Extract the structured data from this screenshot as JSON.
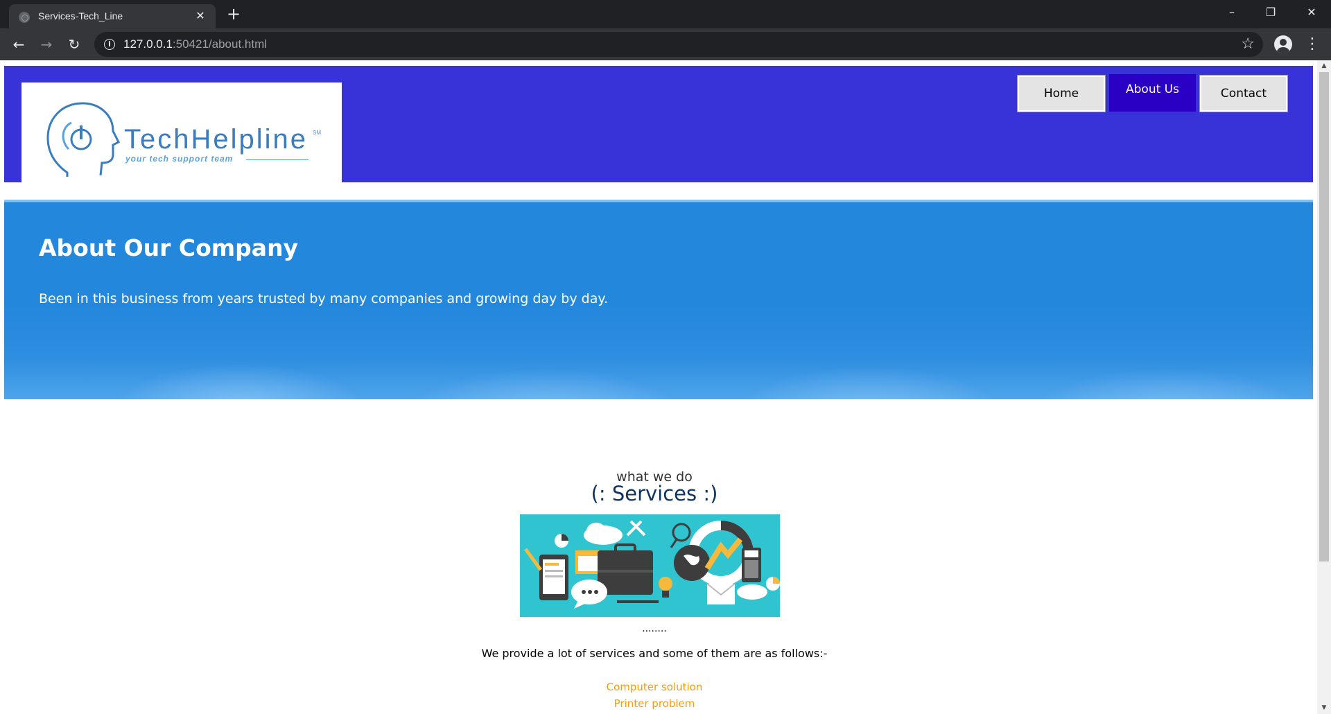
{
  "browser": {
    "tab_title": "Services-Tech_Line",
    "url_host": "127.0.0.1",
    "url_rest": ":50421/about.html"
  },
  "logo": {
    "name": "TechHelpline",
    "mark": "SM",
    "tagline": "your tech support team"
  },
  "nav": {
    "home": "Home",
    "about": "About Us",
    "contact": "Contact"
  },
  "hero": {
    "title": "About Our Company",
    "text": "Been in this business from years trusted by many companies and growing day by day."
  },
  "services": {
    "kicker": "what we do",
    "title": "(: Services :)",
    "dots": "........",
    "intro": "We provide a lot of services and some of them are as follows:-",
    "items": [
      "Computer solution",
      "Printer problem"
    ]
  },
  "colors": {
    "header_bg": "#3733d9",
    "nav_active": "#2a00c4",
    "hero_bg": "#2387dc",
    "service_link": "#f39c12",
    "services_title": "#10325e"
  }
}
